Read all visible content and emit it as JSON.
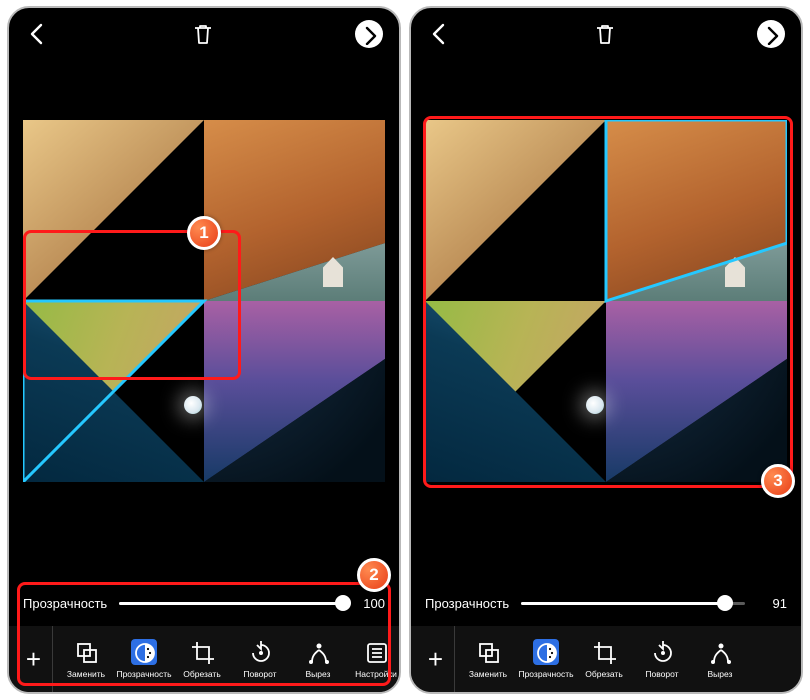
{
  "left": {
    "slider": {
      "label": "Прозрачность",
      "value": 100,
      "pct": 100
    }
  },
  "right": {
    "slider": {
      "label": "Прозрачность",
      "value": 91,
      "pct": 91
    }
  },
  "tools": [
    {
      "key": "replace",
      "label": "Заменить",
      "active": false
    },
    {
      "key": "opacity",
      "label": "Прозрачность",
      "active": true
    },
    {
      "key": "crop",
      "label": "Обрезать",
      "active": false
    },
    {
      "key": "rotate",
      "label": "Поворот",
      "active": false
    },
    {
      "key": "cutout",
      "label": "Вырез",
      "active": false
    },
    {
      "key": "settings",
      "label": "Настройки",
      "active": false
    }
  ],
  "badges": {
    "1": "1",
    "2": "2",
    "3": "3"
  },
  "colors": {
    "accent": "#2d6fe4",
    "highlight": "#ff1a1a",
    "select": "#25c8ff"
  }
}
